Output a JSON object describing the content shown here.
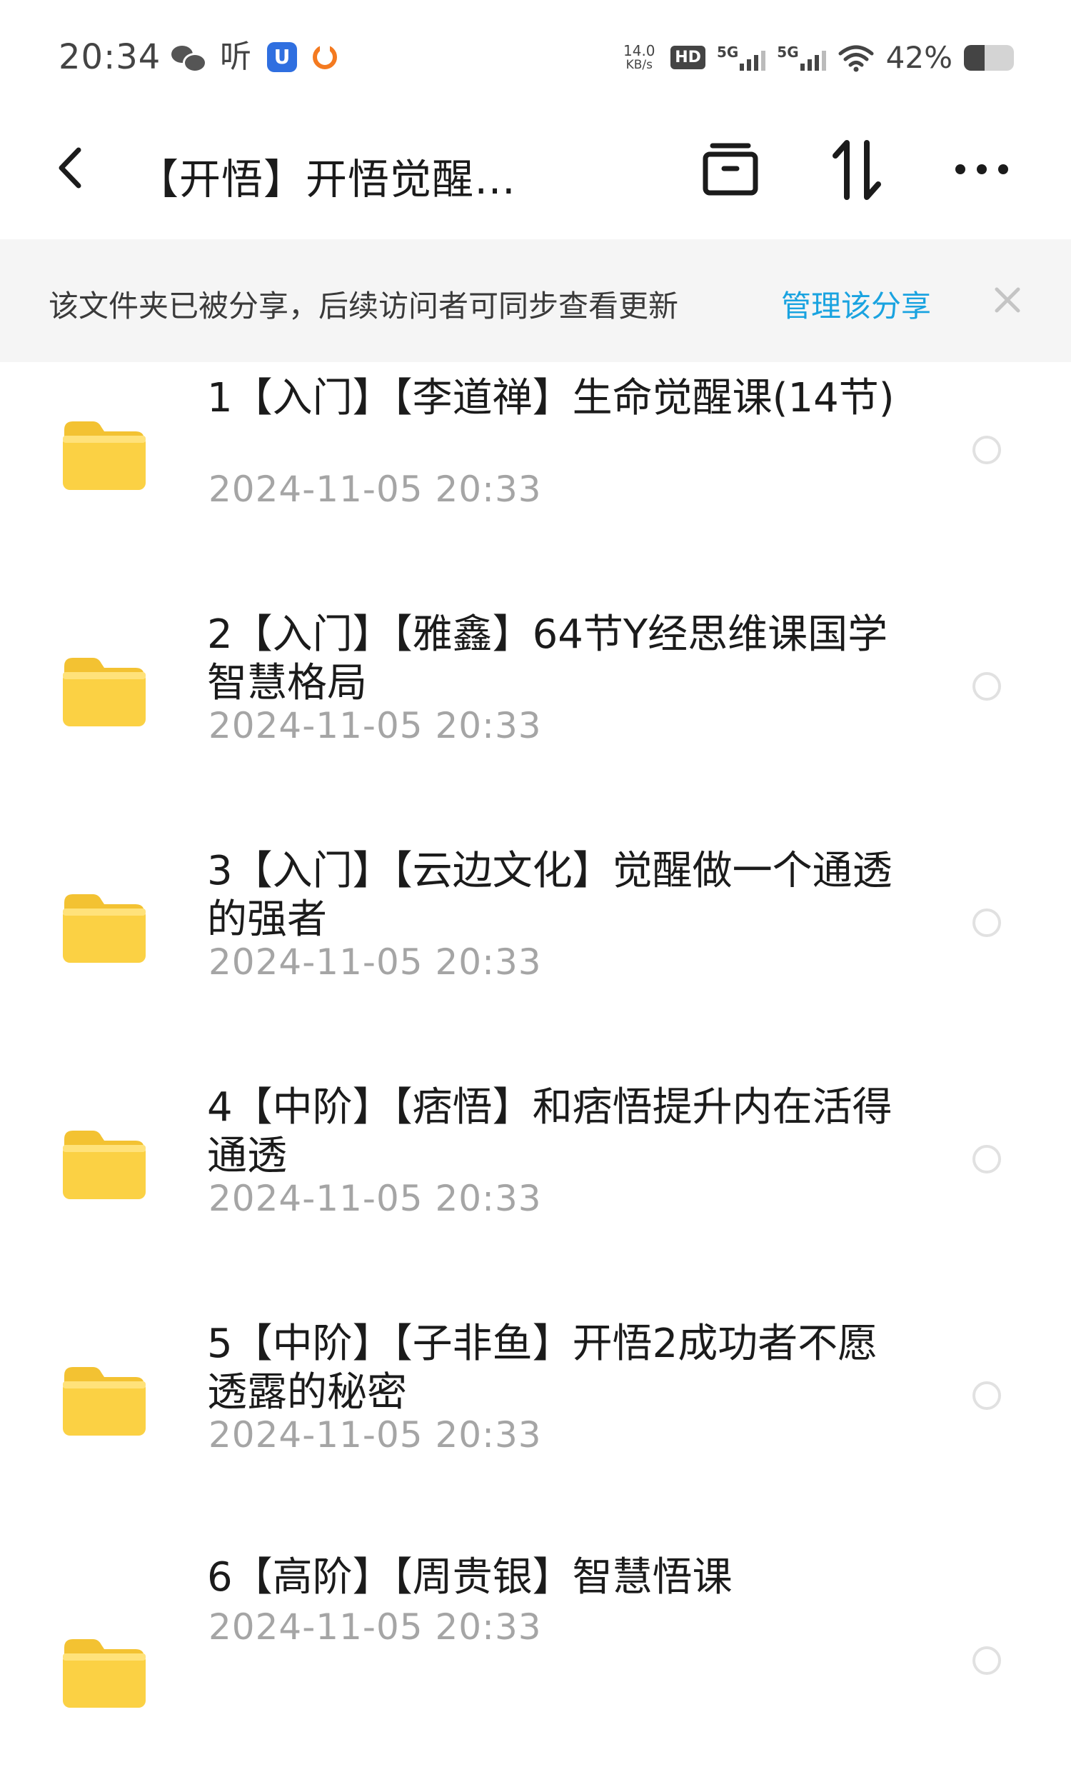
{
  "status_bar": {
    "time": "20:34",
    "ting_glyph": "听",
    "blue_app_glyph": "U",
    "net_speed_value": "14.0",
    "net_speed_unit": "KB/s",
    "hd_label": "HD",
    "sim1_label": "5G",
    "sim2_label": "5G",
    "battery_text": "42%",
    "battery_level": 0.42
  },
  "toolbar": {
    "title": "【开悟】开悟觉醒…"
  },
  "share_banner": {
    "message": "该文件夹已被分享，后续访问者可同步查看更新",
    "manage_link": "管理该分享"
  },
  "colors": {
    "folder": "#fbd144",
    "link": "#1aa3e0",
    "date": "#a5a5a5"
  },
  "files": [
    {
      "name": "1【入门】【李道禅】生命觉醒课(14节)",
      "date": "2024-11-05  20:33"
    },
    {
      "name": "2【入门】【雅鑫】64节Y经思维课国学智慧格局",
      "date": "2024-11-05  20:33"
    },
    {
      "name": "3【入门】【云边文化】觉醒做一个通透的强者",
      "date": "2024-11-05  20:33"
    },
    {
      "name": "4【中阶】【痞悟】和痞悟提升内在活得通透",
      "date": "2024-11-05  20:33"
    },
    {
      "name": "5【中阶】【子非鱼】开悟2成功者不愿透露的秘密",
      "date": "2024-11-05  20:33"
    },
    {
      "name": "6【高阶】【周贵银】智慧悟课",
      "date": "2024-11-05  20:33"
    }
  ]
}
